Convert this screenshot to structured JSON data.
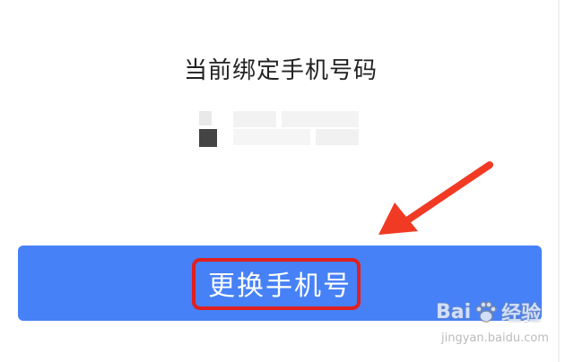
{
  "page": {
    "title": "当前绑定手机号码"
  },
  "button": {
    "label": "更换手机号"
  },
  "watermark": {
    "brand_left": "Bai",
    "brand_right": "经验",
    "url": "jingyan.baidu.com"
  },
  "colors": {
    "button_background": "#4781f7",
    "highlight_border": "#e02020",
    "arrow": "#f13a24"
  },
  "icons": {
    "arrow": "red-pointer-arrow",
    "watermark_logo": "baidu-paw-icon"
  }
}
